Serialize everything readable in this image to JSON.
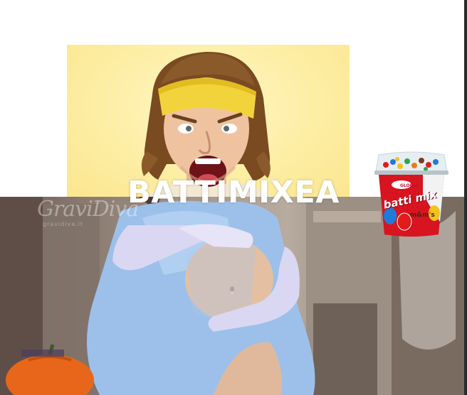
{
  "caption": {
    "text": "BATTIMIXEA"
  },
  "watermark": {
    "text": "GraviDiva",
    "subtext": "gravidiva.it"
  },
  "product": {
    "brand": "GLORIA",
    "name": "batti mix",
    "sub_brand": "m&m's"
  },
  "colors": {
    "top_background": "#fdeea4",
    "headband": "#f3d33b",
    "dress": "#9cc0ea",
    "product_red": "#d7141f",
    "caption": "#ffffff"
  }
}
